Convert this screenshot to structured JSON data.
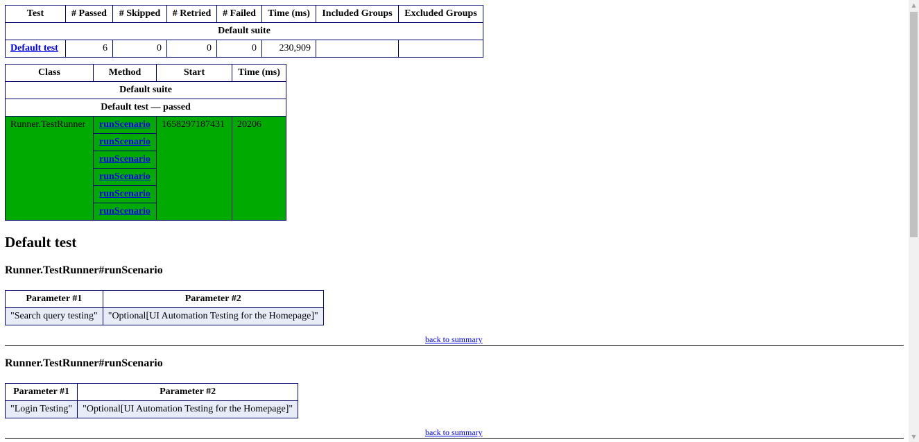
{
  "summary_table": {
    "headers": [
      "Test",
      "# Passed",
      "# Skipped",
      "# Retried",
      "# Failed",
      "Time (ms)",
      "Included Groups",
      "Excluded Groups"
    ],
    "suite_label": "Default suite",
    "row": {
      "test_link": "Default test",
      "passed": "6",
      "skipped": "0",
      "retried": "0",
      "failed": "0",
      "time": "230,909",
      "included": "",
      "excluded": ""
    }
  },
  "methods_table": {
    "headers": [
      "Class",
      "Method",
      "Start",
      "Time (ms)"
    ],
    "suite_label": "Default suite",
    "test_label": "Default test — passed",
    "class_name": "Runner.TestRunner",
    "methods": [
      "runScenario",
      "runScenario",
      "runScenario",
      "runScenario",
      "runScenario",
      "runScenario"
    ],
    "start": "1658297187431",
    "time": "20206"
  },
  "details": {
    "test_heading": "Default test",
    "sections": [
      {
        "heading": "Runner.TestRunner#runScenario",
        "param_headers": [
          "Parameter #1",
          "Parameter #2"
        ],
        "params": [
          "\"Search query testing\"",
          "\"Optional[UI Automation Testing for the Homepage]\""
        ],
        "back_link": "back to summary"
      },
      {
        "heading": "Runner.TestRunner#runScenario",
        "param_headers": [
          "Parameter #1",
          "Parameter #2"
        ],
        "params": [
          "\"Login Testing\"",
          "\"Optional[UI Automation Testing for the Homepage]\""
        ],
        "back_link": "back to summary"
      }
    ]
  },
  "colors": {
    "passed": "#00aa00",
    "border": "#00006e",
    "param_bg": "#e8ecf8",
    "link": "#0000ee"
  },
  "scrollbar": {
    "up_icon": "triangle-up-icon",
    "down_icon": "triangle-down-icon"
  }
}
